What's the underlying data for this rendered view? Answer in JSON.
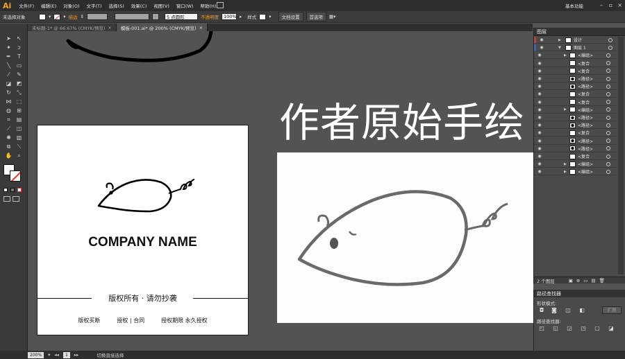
{
  "app": {
    "logo": "Ai"
  },
  "menu": {
    "items": [
      "文件(F)",
      "编辑(E)",
      "对象(O)",
      "文字(T)",
      "选择(S)",
      "效果(C)",
      "视图(V)",
      "窗口(W)",
      "帮助(H)"
    ],
    "workspace": "基本功能"
  },
  "control": {
    "selection": "未选择对象",
    "stroke_label": "描边",
    "brush_value": "5 点圆形",
    "opacity_label": "不透明度",
    "opacity_value": "100%",
    "style_label": "样式",
    "doc_setup": "文档设置",
    "preferences": "首选项"
  },
  "tabs": [
    {
      "label": "未标题-1* @ 66.67% (CMYK/预览)"
    },
    {
      "label": "模板-001.ai* @ 200% (CMYK/预览)"
    }
  ],
  "artboard": {
    "company_name": "COMPANY NAME",
    "copyright": "版权所有 · 请勿抄袭",
    "footer": [
      "版权买断",
      "授权 | 合同",
      "授权期限 永久授权"
    ]
  },
  "canvas": {
    "title": "作者原始手绘"
  },
  "layers": {
    "panel_title": "图层",
    "rows": [
      "设计",
      "图层 1",
      "<编组>",
      "<复合",
      "<复合",
      "<路径>",
      "<路径>",
      "<复合",
      "<复合",
      "<编组>",
      "<路径>",
      "<路径>",
      "<复合",
      "<路径>",
      "<路径>",
      "<复合",
      "<编组>",
      "<编组>"
    ],
    "footer": "2 个图层"
  },
  "pathfinder": {
    "title": "路径查找器",
    "shape_modes_label": "形状模式:",
    "pathfinders_label": "路径查找器:",
    "expand": "扩展"
  },
  "status": {
    "zoom": "200%",
    "page": "1",
    "tool_hint": "切换直接选择"
  },
  "colors": {
    "accent": "#f7a31b",
    "workspace_bg": "#535353",
    "panel_bg": "#4a4a4a"
  }
}
